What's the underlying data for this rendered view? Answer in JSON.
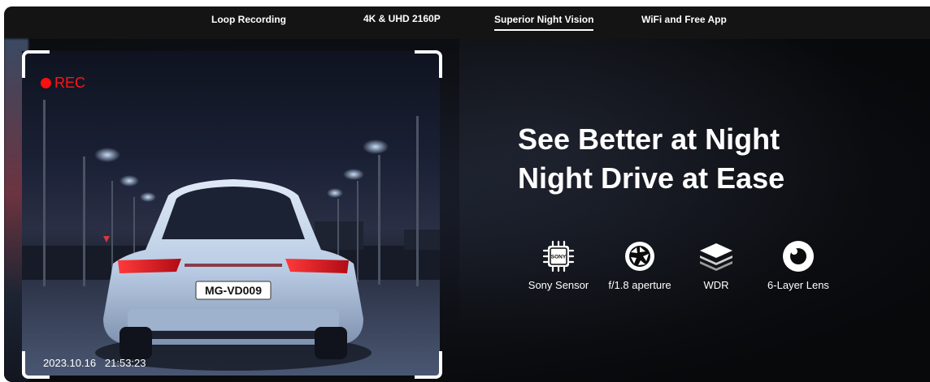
{
  "nav": {
    "tabs": [
      {
        "label": "Loop Recording",
        "active": false
      },
      {
        "label": "4K & UHD 2160P",
        "active": false
      },
      {
        "label": "Superior Night Vision",
        "active": true
      },
      {
        "label": "WiFi and Free App",
        "active": false
      }
    ]
  },
  "camera": {
    "rec_label": "REC",
    "rec_color": "#ff1010",
    "license_plate": "MG-VD009",
    "timestamp": "2023.10.16   21:53:23"
  },
  "headline": {
    "line1": "See Better at Night",
    "line2": "Night Drive at Ease"
  },
  "features": [
    {
      "icon": "sony-sensor-chip-icon",
      "chip_text": "SONY",
      "label": "Sony Sensor"
    },
    {
      "icon": "aperture-icon",
      "label": "f/1.8 aperture"
    },
    {
      "icon": "layers-icon",
      "label": "WDR"
    },
    {
      "icon": "lens-ring-icon",
      "label": "6-Layer Lens"
    }
  ],
  "colors": {
    "background": "#0b0b0d",
    "nav_background": "#141414",
    "text": "#ffffff"
  }
}
